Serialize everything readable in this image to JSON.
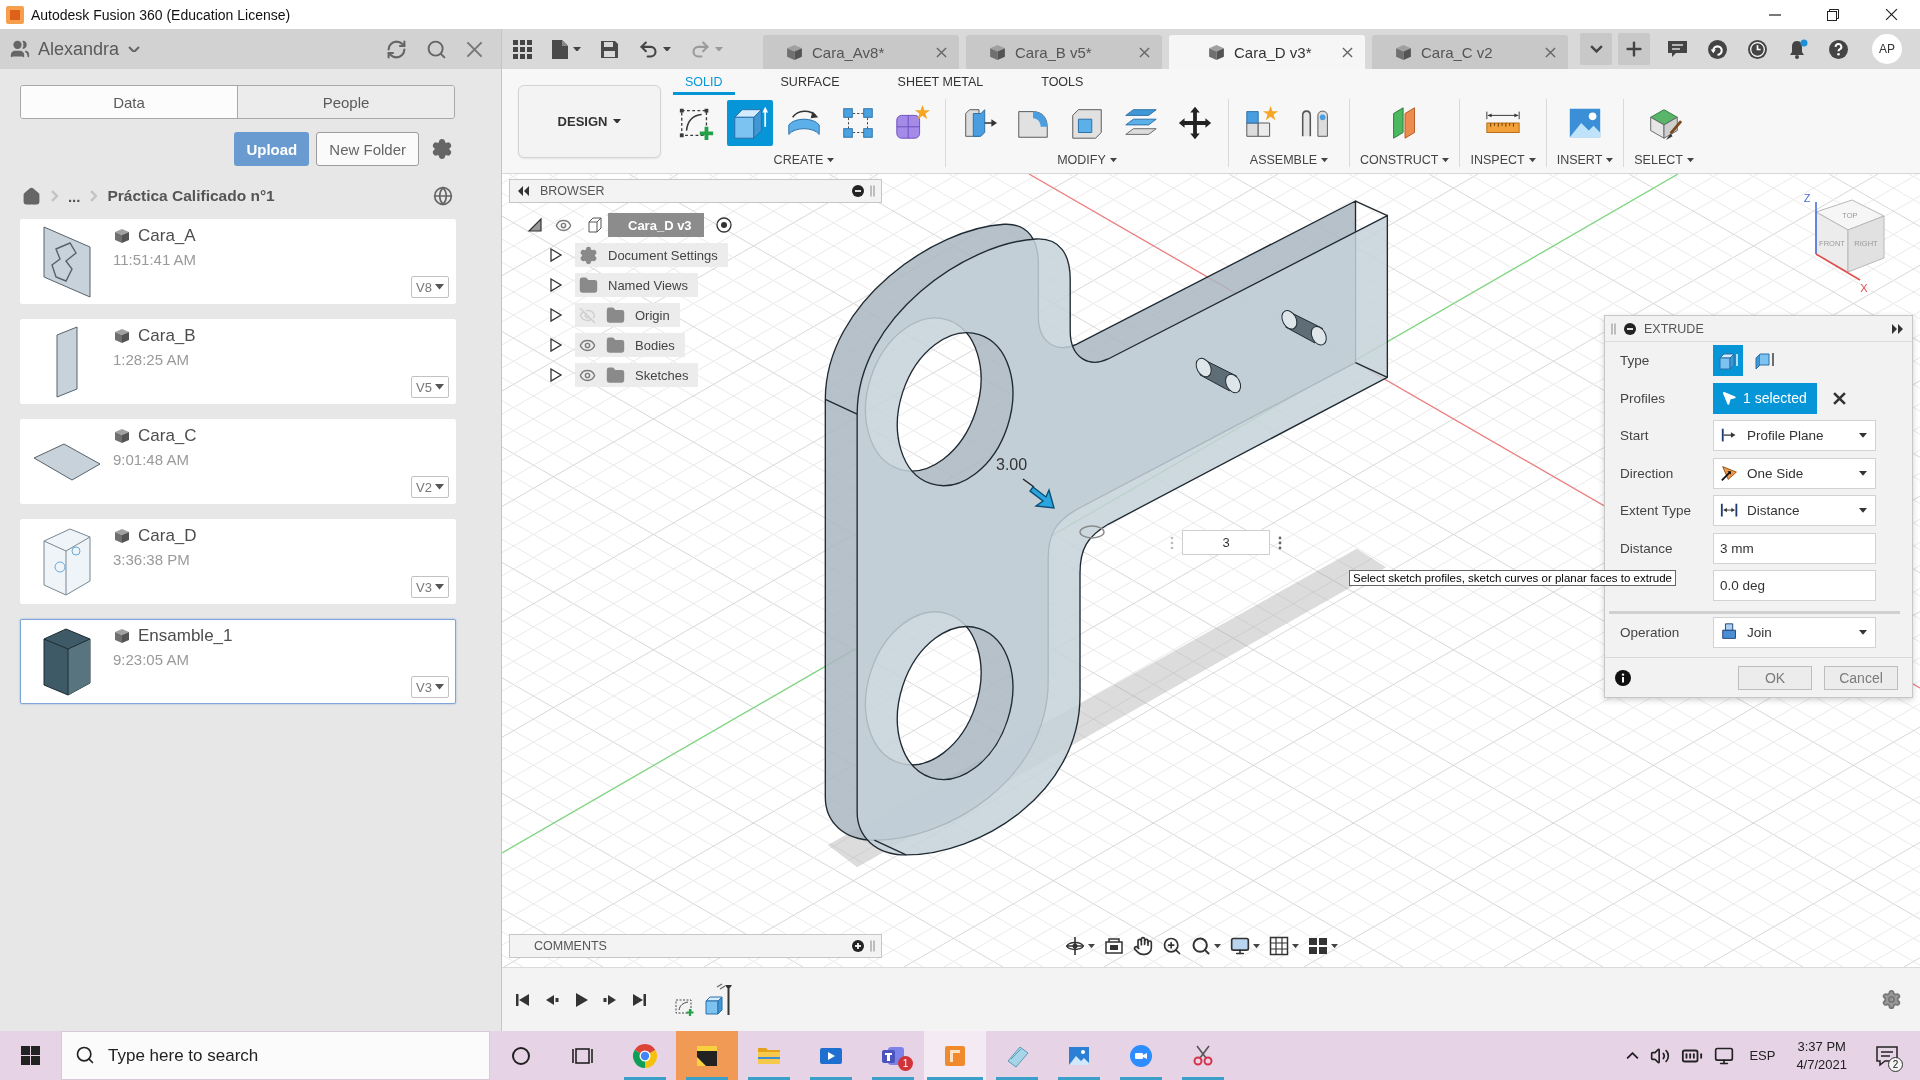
{
  "window": {
    "title": "Autodesk Fusion 360 (Education License)"
  },
  "data_panel": {
    "user": "Alexandra",
    "tabs": [
      {
        "label": "Data",
        "selected": true
      },
      {
        "label": "People",
        "selected": false
      }
    ],
    "actions": [
      {
        "label": "Upload",
        "kind": "primary"
      },
      {
        "label": "New Folder",
        "kind": "secondary"
      }
    ],
    "breadcrumb": [
      "...",
      "Práctica Calificado n°1"
    ],
    "files": [
      {
        "name": "Cara_A",
        "time": "11:51:41 AM",
        "version": "V8",
        "kind": "plate",
        "selected": false
      },
      {
        "name": "Cara_B",
        "time": "1:28:25 AM",
        "version": "V5",
        "kind": "panel",
        "selected": false
      },
      {
        "name": "Cara_C",
        "time": "9:01:48 AM",
        "version": "V2",
        "kind": "flat",
        "selected": false
      },
      {
        "name": "Cara_D",
        "time": "3:36:38 PM",
        "version": "V3",
        "kind": "frame",
        "selected": false
      },
      {
        "name": "Ensamble_1",
        "time": "9:23:05 AM",
        "version": "V3",
        "kind": "assembly",
        "selected": true
      }
    ]
  },
  "document_tabs": [
    {
      "label": "Cara_Av8*",
      "selected": false
    },
    {
      "label": "Cara_B v5*",
      "selected": false
    },
    {
      "label": "Cara_D v3*",
      "selected": true
    },
    {
      "label": "Cara_C v2",
      "selected": false
    }
  ],
  "account": {
    "initials": "AP"
  },
  "ribbon": {
    "workspace": "DESIGN",
    "tabs": [
      {
        "label": "SOLID",
        "selected": true
      },
      {
        "label": "SURFACE",
        "selected": false
      },
      {
        "label": "SHEET METAL",
        "selected": false
      },
      {
        "label": "TOOLS",
        "selected": false
      }
    ],
    "groups": [
      {
        "label": "CREATE",
        "tools": [
          {
            "kind": "sketch",
            "active": false
          },
          {
            "kind": "extrude",
            "active": true
          },
          {
            "kind": "revolve",
            "active": false
          },
          {
            "kind": "pattern",
            "active": false
          },
          {
            "kind": "form",
            "active": false
          }
        ]
      },
      {
        "label": "MODIFY",
        "tools": [
          {
            "kind": "presspull",
            "active": false
          },
          {
            "kind": "fillet",
            "active": false
          },
          {
            "kind": "shell",
            "active": false
          },
          {
            "kind": "combine",
            "active": false
          },
          {
            "kind": "move",
            "active": false
          }
        ]
      },
      {
        "label": "ASSEMBLE",
        "tools": [
          {
            "kind": "component",
            "active": false
          },
          {
            "kind": "joint",
            "active": false
          }
        ]
      },
      {
        "label": "CONSTRUCT",
        "tools": [
          {
            "kind": "plane",
            "active": false
          }
        ]
      },
      {
        "label": "INSPECT",
        "tools": [
          {
            "kind": "measure",
            "active": false
          }
        ]
      },
      {
        "label": "INSERT",
        "tools": [
          {
            "kind": "image",
            "active": false
          }
        ]
      },
      {
        "label": "SELECT",
        "tools": [
          {
            "kind": "select",
            "active": false
          }
        ]
      }
    ]
  },
  "browser": {
    "title": "BROWSER",
    "root": {
      "label": "Cara_D v3",
      "expanded": true,
      "visible": true,
      "selected": true,
      "children": [
        {
          "label": "Document Settings",
          "kind": "settings",
          "expanded": false,
          "selected": false
        },
        {
          "label": "Named Views",
          "kind": "folder",
          "expanded": false,
          "selected": false
        },
        {
          "label": "Origin",
          "kind": "folder",
          "expanded": false,
          "visible": false,
          "selected": false
        },
        {
          "label": "Bodies",
          "kind": "folder",
          "expanded": false,
          "visible": true,
          "selected": false
        },
        {
          "label": "Sketches",
          "kind": "folder",
          "expanded": false,
          "visible": true,
          "selected": false
        }
      ]
    }
  },
  "comments": {
    "title": "COMMENTS"
  },
  "viewport": {
    "dimension": "3.00",
    "distance_input": "3",
    "tooltip": "Select sketch profiles, sketch curves or planar faces to extrude",
    "view_cube": {
      "faces": [
        "TOP",
        "FRONT",
        "RIGHT"
      ],
      "axes": [
        "Z",
        "X"
      ]
    }
  },
  "extrude_dialog": {
    "title": "EXTRUDE",
    "rows": [
      {
        "kind": "type",
        "label": "Type",
        "options": [
          {
            "kind": "solid",
            "selected": true
          },
          {
            "kind": "surface",
            "selected": false
          }
        ]
      },
      {
        "kind": "profiles",
        "label": "Profiles",
        "value": "1 selected"
      },
      {
        "kind": "start",
        "label": "Start",
        "value": "Profile Plane"
      },
      {
        "kind": "direction",
        "label": "Direction",
        "value": "One Side"
      },
      {
        "kind": "extent",
        "label": "Extent Type",
        "value": "Distance"
      },
      {
        "kind": "distance",
        "label": "Distance",
        "value": "3 mm"
      },
      {
        "kind": "taper",
        "value": "0.0 deg"
      },
      {
        "kind": "operation",
        "label": "Operation",
        "value": "Join"
      }
    ],
    "buttons": [
      "OK",
      "Cancel"
    ]
  },
  "taskbar": {
    "search": {
      "placeholder": "Type here to search"
    },
    "apps": [
      {
        "kind": "wheel",
        "running": true,
        "selected": false,
        "flashing": false
      },
      {
        "kind": "note",
        "running": true,
        "selected": false,
        "flashing": true
      },
      {
        "kind": "folder",
        "running": true,
        "selected": false,
        "flashing": false
      },
      {
        "kind": "player",
        "running": true,
        "selected": false,
        "flashing": false
      },
      {
        "kind": "team",
        "running": true,
        "selected": false,
        "flashing": false,
        "badge": "1"
      },
      {
        "kind": "cad",
        "running": true,
        "selected": true,
        "flashing": false
      },
      {
        "kind": "papers",
        "running": true,
        "selected": false,
        "flashing": false
      },
      {
        "kind": "photos",
        "running": true,
        "selected": false,
        "flashing": false
      },
      {
        "kind": "camera",
        "running": true,
        "selected": false,
        "flashing": false
      },
      {
        "kind": "scissors",
        "running": true,
        "selected": false,
        "flashing": false
      }
    ],
    "language": "ESP",
    "time": "3:37 PM",
    "date": "4/7/2021",
    "notification_count": "2"
  }
}
